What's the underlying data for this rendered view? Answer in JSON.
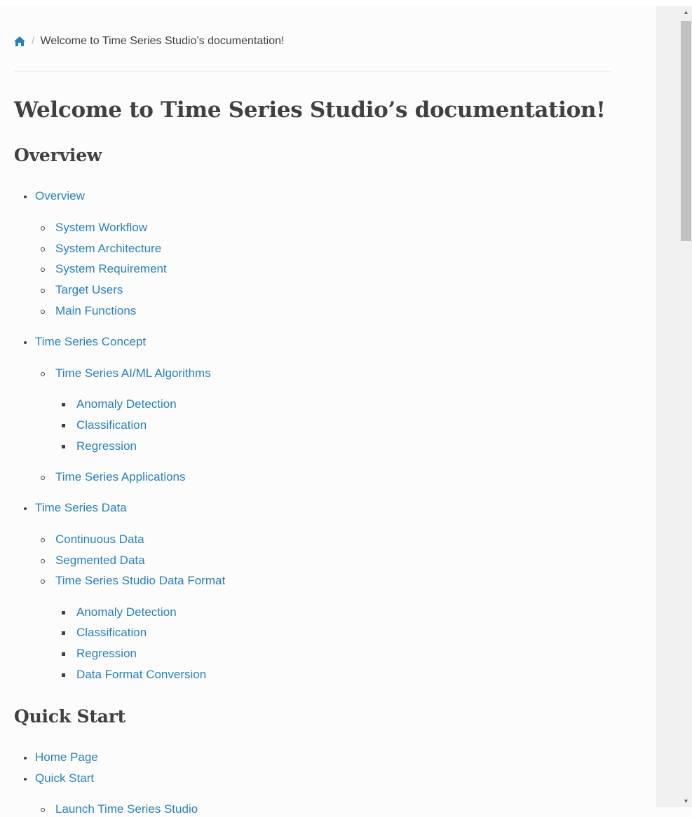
{
  "breadcrumb": {
    "home_icon": "home-icon",
    "separator": "/",
    "current": "Welcome to Time Series Studio’s documentation!"
  },
  "page_title": "Welcome to Time Series Studio’s documentation!",
  "sections": {
    "overview_heading": "Overview",
    "quick_start_heading": "Quick Start"
  },
  "toc_overview": {
    "overview": "Overview",
    "system_workflow": "System Workflow",
    "system_architecture": "System Architecture",
    "system_requirement": "System Requirement",
    "target_users": "Target Users",
    "main_functions": "Main Functions",
    "time_series_concept": "Time Series Concept",
    "ai_ml_algorithms": "Time Series AI/ML Algorithms",
    "anomaly_detection_1": "Anomaly Detection",
    "classification_1": "Classification",
    "regression_1": "Regression",
    "time_series_applications": "Time Series Applications",
    "time_series_data": "Time Series Data",
    "continuous_data": "Continuous Data",
    "segmented_data": "Segmented Data",
    "data_format": "Time Series Studio Data Format",
    "anomaly_detection_2": "Anomaly Detection",
    "classification_2": "Classification",
    "regression_2": "Regression",
    "data_format_conversion": "Data Format Conversion"
  },
  "toc_quick_start": {
    "home_page": "Home Page",
    "quick_start": "Quick Start",
    "launch": "Launch Time Series Studio"
  },
  "colors": {
    "link": "#2980b9",
    "text": "#404040",
    "background": "#fcfcfc"
  }
}
